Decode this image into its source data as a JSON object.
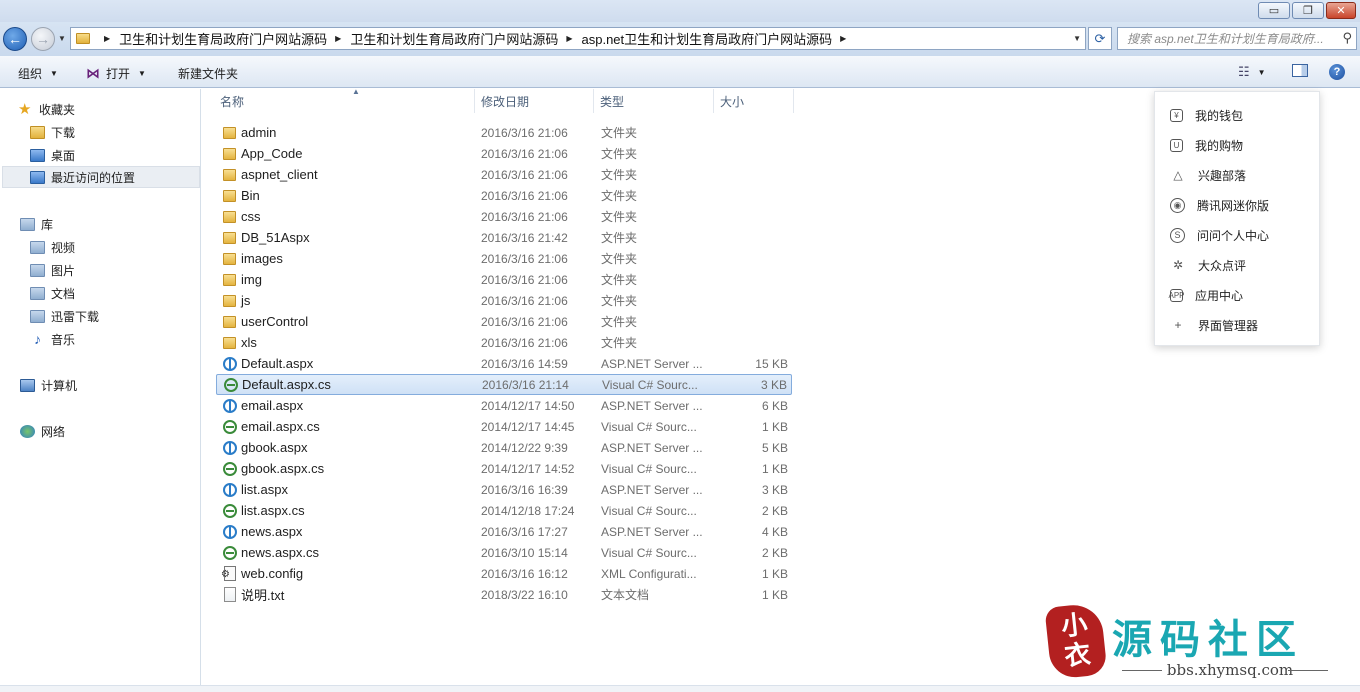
{
  "window": {
    "minimize_glyph": "▭",
    "restore_glyph": "❐",
    "close_glyph": "✕"
  },
  "address": {
    "crumbs": [
      "卫生和计划生育局政府门户网站源码",
      "卫生和计划生育局政府门户网站源码",
      "asp.net卫生和计划生育局政府门户网站源码"
    ],
    "search_placeholder": "搜索 asp.net卫生和计划生育局政府..."
  },
  "toolbar": {
    "organize": "组织",
    "open": "打开",
    "new_folder": "新建文件夹"
  },
  "sidebar": {
    "favorites": {
      "title": "收藏夹",
      "items": [
        "下载",
        "桌面",
        "最近访问的位置"
      ]
    },
    "libraries": {
      "title": "库",
      "items": [
        "视频",
        "图片",
        "文档",
        "迅雷下载",
        "音乐"
      ]
    },
    "computer": "计算机",
    "network": "网络"
  },
  "columns": {
    "name": "名称",
    "date": "修改日期",
    "type": "类型",
    "size": "大小"
  },
  "files": [
    {
      "name": "admin",
      "date": "2016/3/16 21:06",
      "type": "文件夹",
      "size": "",
      "icon": "folder"
    },
    {
      "name": "App_Code",
      "date": "2016/3/16 21:06",
      "type": "文件夹",
      "size": "",
      "icon": "folder"
    },
    {
      "name": "aspnet_client",
      "date": "2016/3/16 21:06",
      "type": "文件夹",
      "size": "",
      "icon": "folder"
    },
    {
      "name": "Bin",
      "date": "2016/3/16 21:06",
      "type": "文件夹",
      "size": "",
      "icon": "folder"
    },
    {
      "name": "css",
      "date": "2016/3/16 21:06",
      "type": "文件夹",
      "size": "",
      "icon": "folder"
    },
    {
      "name": "DB_51Aspx",
      "date": "2016/3/16 21:42",
      "type": "文件夹",
      "size": "",
      "icon": "folder"
    },
    {
      "name": "images",
      "date": "2016/3/16 21:06",
      "type": "文件夹",
      "size": "",
      "icon": "folder"
    },
    {
      "name": "img",
      "date": "2016/3/16 21:06",
      "type": "文件夹",
      "size": "",
      "icon": "folder"
    },
    {
      "name": "js",
      "date": "2016/3/16 21:06",
      "type": "文件夹",
      "size": "",
      "icon": "folder"
    },
    {
      "name": "userControl",
      "date": "2016/3/16 21:06",
      "type": "文件夹",
      "size": "",
      "icon": "folder"
    },
    {
      "name": "xls",
      "date": "2016/3/16 21:06",
      "type": "文件夹",
      "size": "",
      "icon": "folder"
    },
    {
      "name": "Default.aspx",
      "date": "2016/3/16 14:59",
      "type": "ASP.NET Server ...",
      "size": "15 KB",
      "icon": "aspx"
    },
    {
      "name": "Default.aspx.cs",
      "date": "2016/3/16 21:14",
      "type": "Visual C# Sourc...",
      "size": "3 KB",
      "icon": "cs",
      "selected": true
    },
    {
      "name": "email.aspx",
      "date": "2014/12/17 14:50",
      "type": "ASP.NET Server ...",
      "size": "6 KB",
      "icon": "aspx"
    },
    {
      "name": "email.aspx.cs",
      "date": "2014/12/17 14:45",
      "type": "Visual C# Sourc...",
      "size": "1 KB",
      "icon": "cs"
    },
    {
      "name": "gbook.aspx",
      "date": "2014/12/22 9:39",
      "type": "ASP.NET Server ...",
      "size": "5 KB",
      "icon": "aspx"
    },
    {
      "name": "gbook.aspx.cs",
      "date": "2014/12/17 14:52",
      "type": "Visual C# Sourc...",
      "size": "1 KB",
      "icon": "cs"
    },
    {
      "name": "list.aspx",
      "date": "2016/3/16 16:39",
      "type": "ASP.NET Server ...",
      "size": "3 KB",
      "icon": "aspx"
    },
    {
      "name": "list.aspx.cs",
      "date": "2014/12/18 17:24",
      "type": "Visual C# Sourc...",
      "size": "2 KB",
      "icon": "cs"
    },
    {
      "name": "news.aspx",
      "date": "2016/3/16 17:27",
      "type": "ASP.NET Server ...",
      "size": "4 KB",
      "icon": "aspx"
    },
    {
      "name": "news.aspx.cs",
      "date": "2016/3/10 15:14",
      "type": "Visual C# Sourc...",
      "size": "2 KB",
      "icon": "cs"
    },
    {
      "name": "web.config",
      "date": "2016/3/16 16:12",
      "type": "XML Configurati...",
      "size": "1 KB",
      "icon": "config"
    },
    {
      "name": "说明.txt",
      "date": "2018/3/22 16:10",
      "type": "文本文档",
      "size": "1 KB",
      "icon": "txt"
    }
  ],
  "popup_menu": [
    {
      "label": "我的钱包",
      "icon": "wallet-icon",
      "glyph": "¥"
    },
    {
      "label": "我的购物",
      "icon": "shopping-bag-icon",
      "glyph": "U"
    },
    {
      "label": "兴趣部落",
      "icon": "tribe-icon",
      "glyph": "△"
    },
    {
      "label": "腾讯网迷你版",
      "icon": "tencent-news-icon",
      "glyph": "◉"
    },
    {
      "label": "问问个人中心",
      "icon": "wenwen-icon",
      "glyph": "S"
    },
    {
      "label": "大众点评",
      "icon": "dianping-icon",
      "glyph": "✲"
    },
    {
      "label": "应用中心",
      "icon": "app-center-icon",
      "glyph": "APP"
    },
    {
      "label": "界面管理器",
      "icon": "plus-icon",
      "glyph": "+"
    }
  ],
  "watermark": {
    "seal_text": "小\n衣",
    "title": "源码社区",
    "url": "bbs.xhymsq.com"
  }
}
